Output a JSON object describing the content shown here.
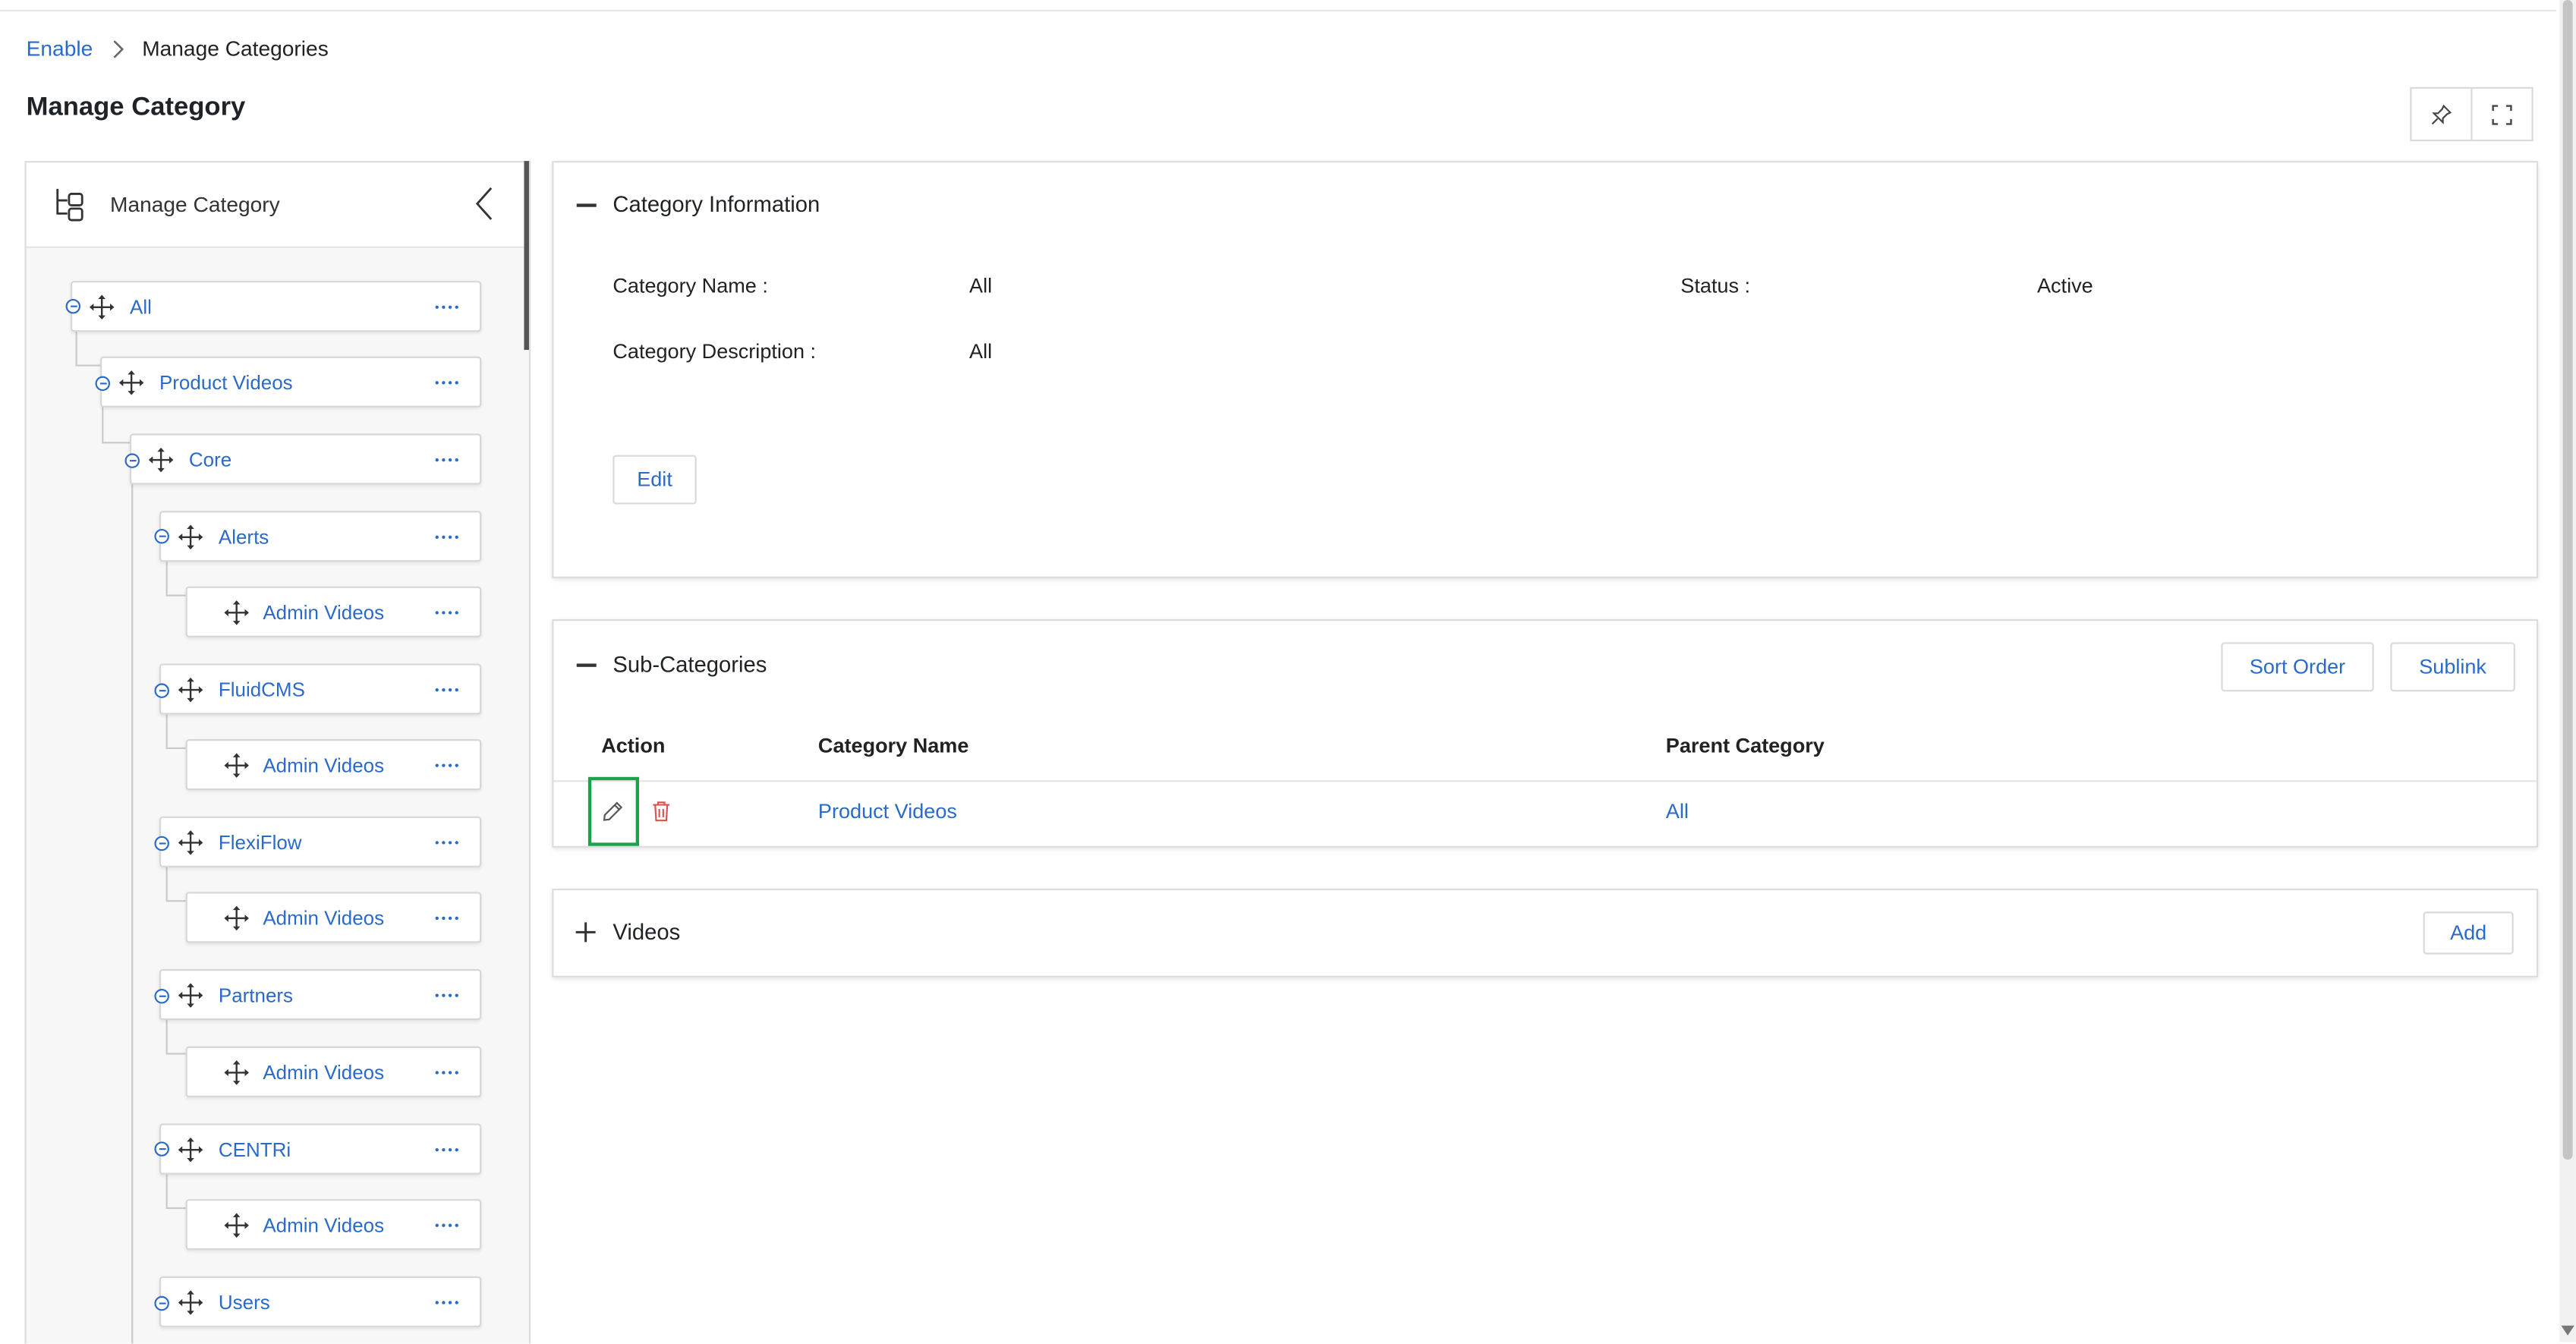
{
  "breadcrumb": {
    "root": "Enable",
    "current": "Manage Categories"
  },
  "page_title": "Manage Category",
  "left_panel": {
    "title": "Manage Category"
  },
  "tree": {
    "all": "All",
    "product_videos": "Product Videos",
    "core": "Core",
    "alerts": "Alerts",
    "alerts_admin": "Admin Videos",
    "fluidcms": "FluidCMS",
    "fluidcms_admin": "Admin Videos",
    "flexiflow": "FlexiFlow",
    "flexiflow_admin": "Admin Videos",
    "partners": "Partners",
    "partners_admin": "Admin Videos",
    "centri": "CENTRi",
    "centri_admin": "Admin Videos",
    "users": "Users"
  },
  "category_info": {
    "title": "Category Information",
    "name_label": "Category Name :",
    "name_value": "All",
    "status_label": "Status :",
    "status_value": "Active",
    "desc_label": "Category Description :",
    "desc_value": "All",
    "edit_label": "Edit"
  },
  "sub_categories": {
    "title": "Sub-Categories",
    "sort_order_label": "Sort Order",
    "sublink_label": "Sublink",
    "columns": {
      "action": "Action",
      "category_name": "Category Name",
      "parent_category": "Parent Category"
    },
    "rows": [
      {
        "category_name": "Product Videos",
        "parent_category": "All"
      }
    ]
  },
  "videos": {
    "title": "Videos",
    "add_label": "Add"
  },
  "colors": {
    "link": "#2a6ac8",
    "delete": "#d9534f",
    "highlight": "#1aa34a"
  }
}
